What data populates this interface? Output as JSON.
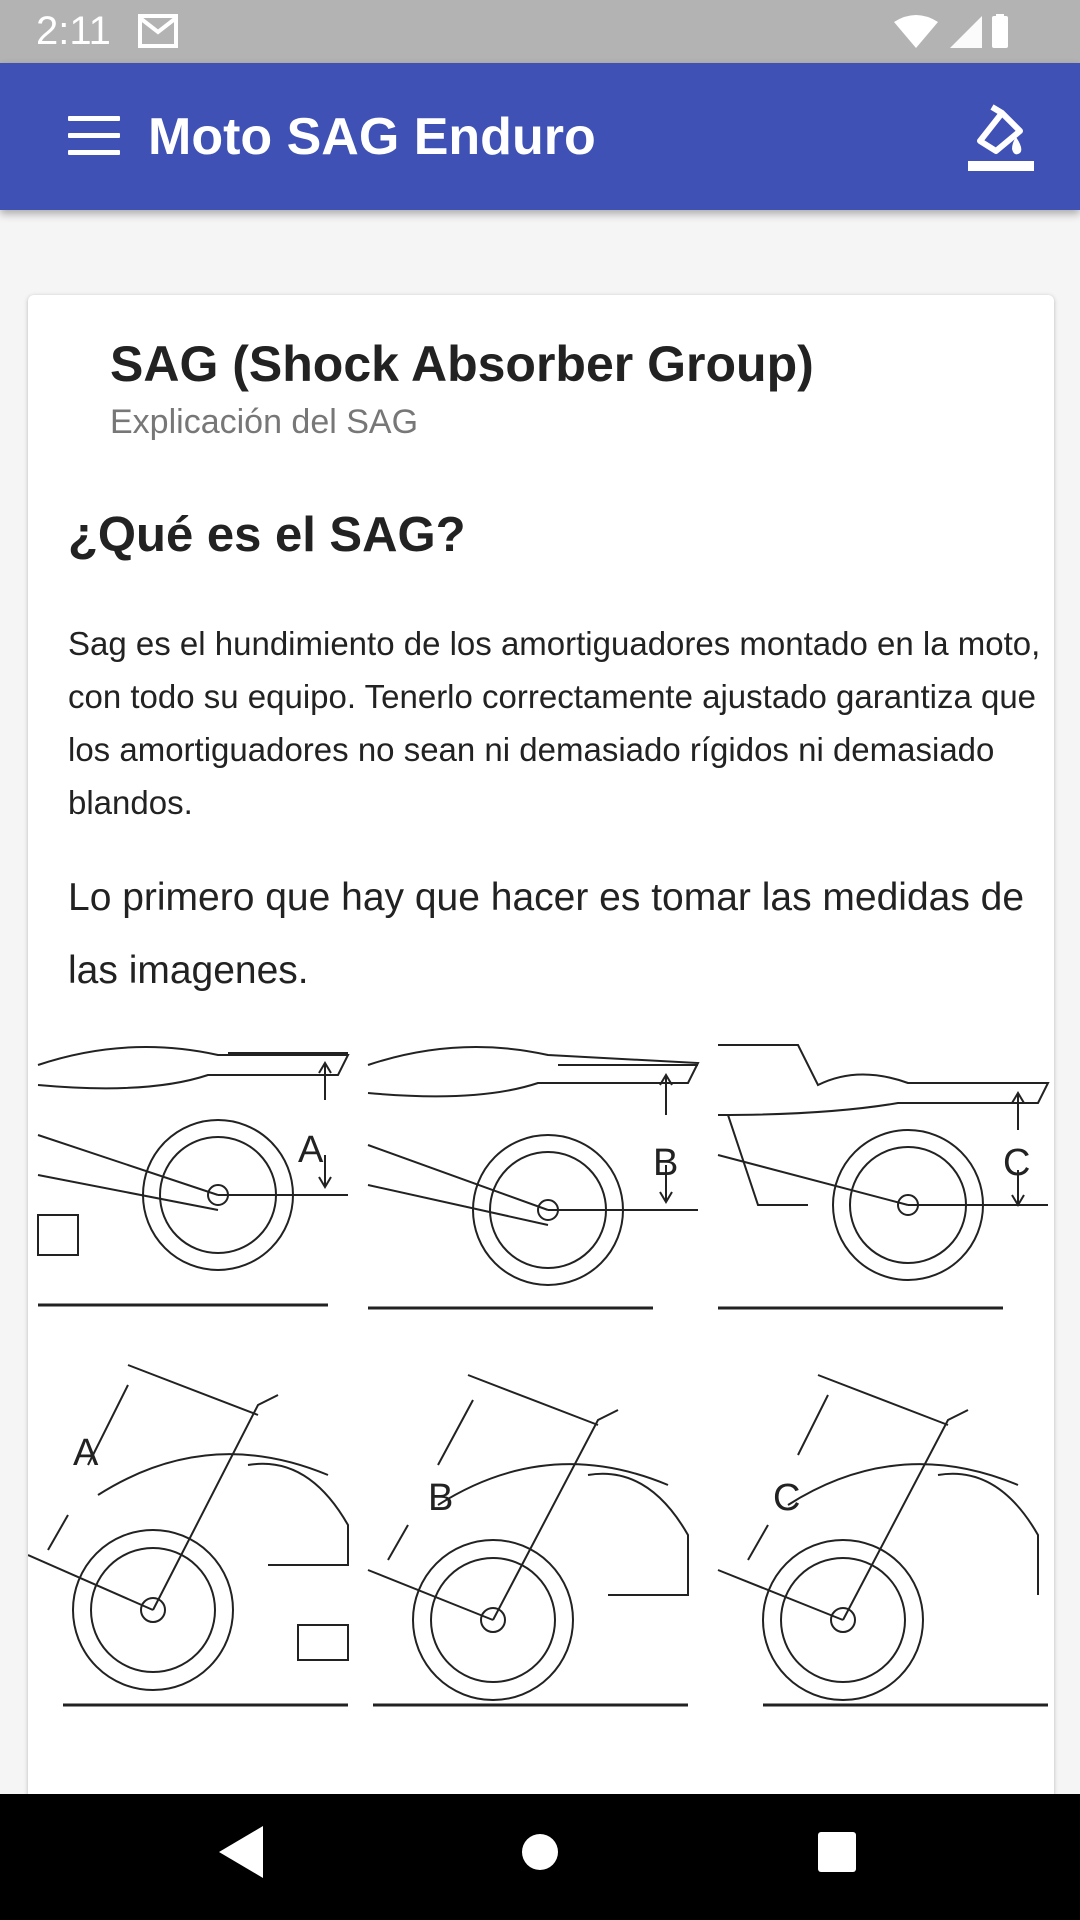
{
  "status_bar": {
    "time": "2:11"
  },
  "app_bar": {
    "title": "Moto SAG Enduro"
  },
  "card": {
    "title": "SAG (Shock Absorber Group)",
    "subtitle": "Explicación del SAG",
    "heading": "¿Qué es el SAG?",
    "paragraph1": "Sag es el hundimiento de los amortiguadores montado en la moto, con todo su equipo. Tenerlo correctamente ajustado garantiza que los amortiguadores no sean ni demasiado rígidos ni demasiado blandos.",
    "paragraph2": "Lo primero que hay que hacer es tomar las medidas de las imagenes."
  },
  "figure": {
    "top_labels": [
      "A",
      "B",
      "C"
    ],
    "bottom_labels": [
      "A",
      "B",
      "C"
    ]
  },
  "colors": {
    "primary": "#3f51b5",
    "status_bar": "#b3b3b3",
    "nav_bar": "#000000"
  },
  "icons": [
    "mail-icon",
    "wifi-icon",
    "signal-icon",
    "battery-icon",
    "menu-icon",
    "format-paint-icon",
    "back-icon",
    "home-icon",
    "recents-icon"
  ]
}
